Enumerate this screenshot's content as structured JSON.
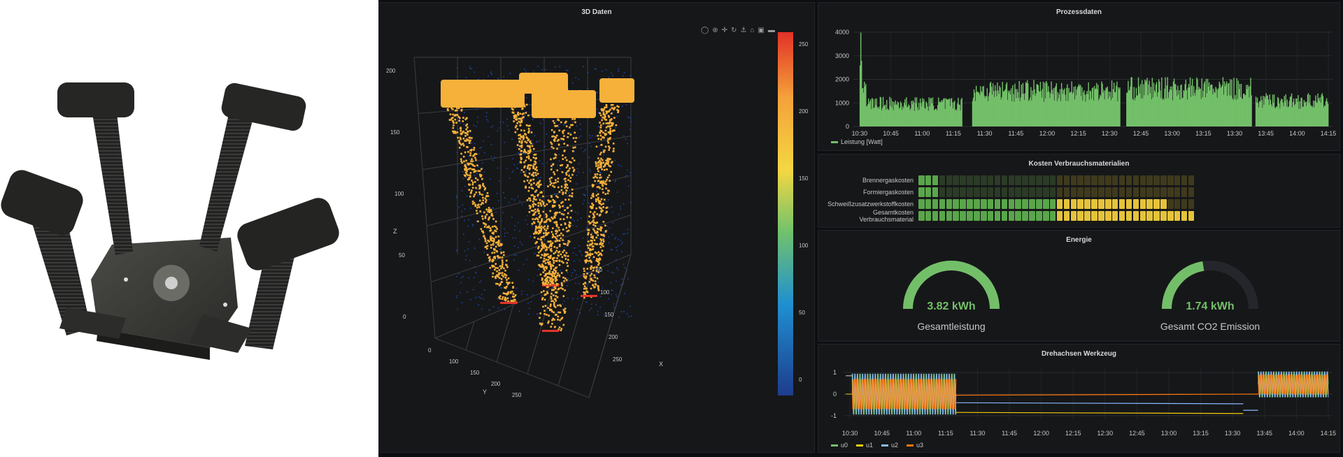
{
  "panels": {
    "daten3d": {
      "title": "3D Daten"
    },
    "prozess": {
      "title": "Prozessdaten"
    },
    "kosten": {
      "title": "Kosten Verbrauchsmaterialien"
    },
    "energie": {
      "title": "Energie"
    },
    "dreh": {
      "title": "Drehachsen Werkzeug"
    }
  },
  "toolbar": {
    "icons": [
      "camera-icon",
      "zoom-icon",
      "pan-icon",
      "orbit-icon",
      "turntable-icon",
      "home-icon",
      "save-icon",
      "toggle-icon"
    ]
  },
  "scene3d": {
    "axis_labels": {
      "x": "X",
      "y": "Y",
      "z": "Z"
    },
    "z_ticks": [
      "200",
      "150",
      "100",
      "50",
      "0"
    ],
    "y_ticks": [
      "0",
      "100",
      "150",
      "200",
      "250"
    ],
    "x_ticks": [
      "50",
      "100",
      "150",
      "200",
      "250"
    ],
    "colorbar_ticks": [
      "250",
      "200",
      "150",
      "100",
      "50",
      "0"
    ],
    "colors": {
      "points": "#f6b13a",
      "noise": "#1f4fb8",
      "tip": "#e0342b"
    }
  },
  "prozessdaten": {
    "chart_data": {
      "type": "bar",
      "x_ticks": [
        "10:30",
        "10:45",
        "11:00",
        "11:15",
        "11:30",
        "11:45",
        "12:00",
        "12:15",
        "12:30",
        "12:45",
        "13:00",
        "13:15",
        "13:30",
        "13:45",
        "14:00",
        "14:15"
      ],
      "y_ticks": [
        "4000",
        "3000",
        "2000",
        "1000",
        "0"
      ],
      "ylim": [
        0,
        4000
      ],
      "series": [
        {
          "name": "Leistung [Watt]",
          "color": "#73bf69"
        }
      ],
      "segments": [
        {
          "from": "10:30",
          "to": "10:31",
          "value": 3800
        },
        {
          "from": "10:31",
          "to": "10:33",
          "value": 2500
        },
        {
          "from": "10:33",
          "to": "11:19",
          "value": 1200
        },
        {
          "from": "11:24",
          "to": "12:35",
          "value": 1900
        },
        {
          "from": "12:38",
          "to": "13:38",
          "value": 2000
        },
        {
          "from": "13:40",
          "to": "14:15",
          "value": 1350
        }
      ]
    }
  },
  "kosten": {
    "chart_data": {
      "type": "heatmap",
      "rows": [
        "Brennergaskosten",
        "Formiergaskosten",
        "Schweißzusatzwerkstoffkosten",
        "Gesamtkosten Verbrauchsmaterial"
      ],
      "cells_total": 40,
      "filled_green": [
        3,
        3,
        20,
        20
      ],
      "filled_yellow": [
        0,
        0,
        16,
        20
      ],
      "colors": {
        "green": "#5aa64b",
        "yellow": "#e5c33b",
        "dim_green": "#2b3b26",
        "dim_yellow": "#3f3a1d"
      }
    }
  },
  "energie": {
    "gauges": [
      {
        "value": "3.82 kWh",
        "label": "Gesamtleistung",
        "fraction": 1.0,
        "color": "#73bf69"
      },
      {
        "value": "1.74 kWh",
        "label": "Gesamt CO2 Emission",
        "fraction": 0.45,
        "color": "#73bf69"
      }
    ]
  },
  "drehachsen": {
    "chart_data": {
      "type": "line",
      "x_ticks": [
        "10:30",
        "10:45",
        "11:00",
        "11:15",
        "11:30",
        "11:45",
        "12:00",
        "12:15",
        "12:30",
        "12:45",
        "13:00",
        "13:15",
        "13:30",
        "13:45",
        "14:00",
        "14:15"
      ],
      "y_ticks": [
        "1",
        "0",
        "-1"
      ],
      "ylim": [
        -1.2,
        1.2
      ],
      "series": [
        {
          "name": "u0",
          "color": "#73bf69"
        },
        {
          "name": "u1",
          "color": "#f2cc0c"
        },
        {
          "name": "u2",
          "color": "#8ab8ff"
        },
        {
          "name": "u3",
          "color": "#ff780a"
        }
      ]
    }
  }
}
